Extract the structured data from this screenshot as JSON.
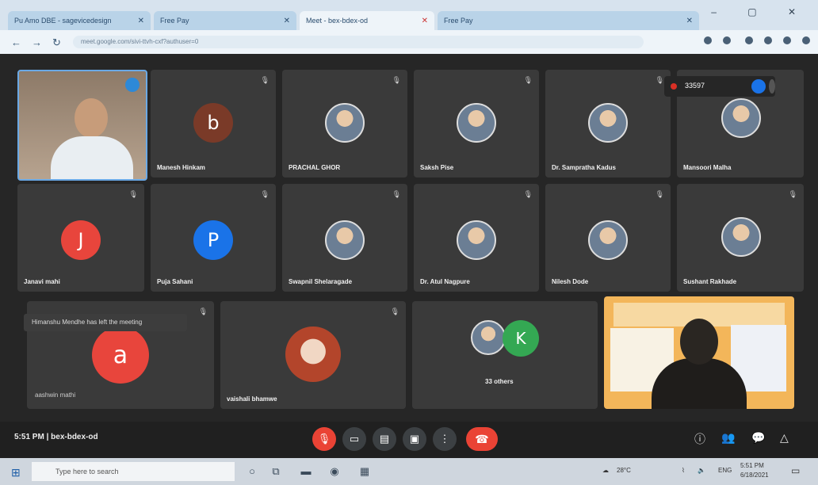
{
  "browser": {
    "tabs": [
      {
        "label": "Pu Amo DBE - sagevicedesign",
        "active": false
      },
      {
        "label": "Free Pay",
        "active": false
      },
      {
        "label": "Meet - bex-bdex-od",
        "active": true
      },
      {
        "label": "Free Pay",
        "active": false
      }
    ],
    "url": "meet.google.com/sivi-ttvh-cxf?authuser=0"
  },
  "tiles": [
    {
      "name": "Manesh Hinkam",
      "initial": "b",
      "color": "#7a3a28"
    },
    {
      "name": "PRACHAL GHOR",
      "initial": "",
      "color": ""
    },
    {
      "name": "Saksh Pise",
      "initial": "",
      "color": ""
    },
    {
      "name": "Dr. Sampratha Kadus",
      "initial": "",
      "color": ""
    },
    {
      "name": "Mansoori Malha",
      "initial": "",
      "color": ""
    },
    {
      "name": "Janavi mahi",
      "initial": "J",
      "color": "#e8453c"
    },
    {
      "name": "Puja Sahani",
      "initial": "P",
      "color": "#1a73e8"
    },
    {
      "name": "Swapnil Shelaragade",
      "initial": "",
      "color": ""
    },
    {
      "name": "Dr. Atul Nagpure",
      "initial": "",
      "color": ""
    },
    {
      "name": "Nilesh Dode",
      "initial": "",
      "color": ""
    },
    {
      "name": "Sushant Rakhade",
      "initial": "",
      "color": ""
    },
    {
      "name": "",
      "initial": "a",
      "color": "#e8453c"
    },
    {
      "name": "vaishali bhamwe",
      "initial": "",
      "color": ""
    },
    {
      "name": "33 others",
      "initial": "K",
      "color": "#34a853"
    }
  ],
  "notification": {
    "text": "Himanshu Mendhe has left the meeting",
    "sub": "aashwin mathi"
  },
  "recording": {
    "label": "33597"
  },
  "toolbar": {
    "time": "5:51 PM",
    "meeting_code": "bex-bdex-od"
  },
  "taskbar": {
    "search_placeholder": "Type here to search",
    "weather": "28°C",
    "lang": "ENG",
    "clock_time": "5:51 PM",
    "clock_date": "6/18/2021"
  },
  "colors": {
    "accent": "#1a73e8",
    "danger": "#ea4335",
    "tile_bg": "#3a3a3a"
  }
}
